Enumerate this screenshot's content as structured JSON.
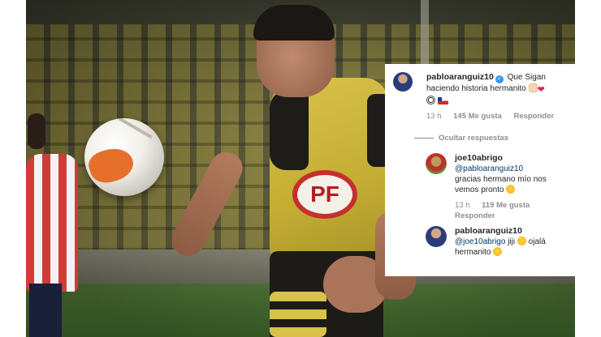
{
  "comments": [
    {
      "username": "pabloaranguiz10",
      "verified": true,
      "text": "Que Sigan haciendo historia hermanito",
      "time": "13 h",
      "likes": "145 Me gusta",
      "reply_label": "Responder"
    }
  ],
  "hide_replies_label": "Ocultar respuestas",
  "replies": [
    {
      "username": "joe10abrigo",
      "mention": "@pabloaranguiz10",
      "text": "gracias hermano mío nos vemos pronto",
      "time": "13 h",
      "likes": "119 Me gusta",
      "reply_label": "Responder"
    },
    {
      "username": "pabloaranguiz10",
      "mention": "@joe10abrigo",
      "text": "jiji",
      "text2": "ojalá hermanito"
    }
  ],
  "photo": {
    "sponsor_text": "PF"
  },
  "icons": {
    "verified": "verified-badge-icon",
    "heart": "heart-emoji",
    "flag": "chile-flag-emoji"
  },
  "colors": {
    "verified": "#3897f0",
    "meta": "#8e8e8e",
    "mention": "#00376b"
  }
}
